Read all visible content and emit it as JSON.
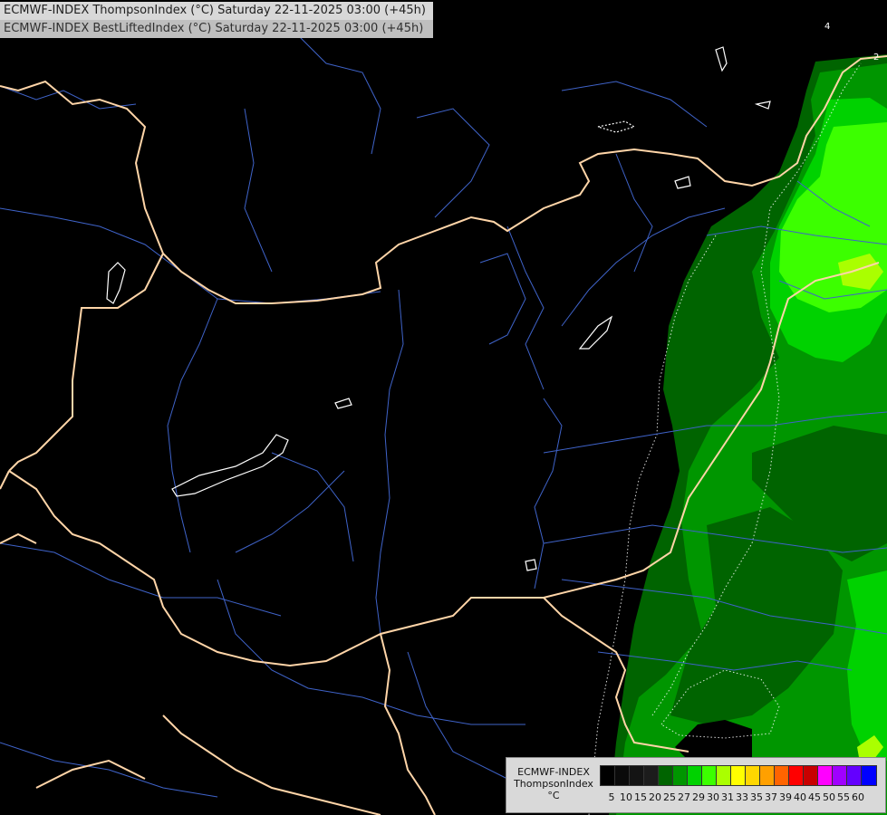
{
  "titles": {
    "line1": "ECMWF-INDEX ThompsonIndex (°C) Saturday 22-11-2025 03:00 (+45h)",
    "line2": "ECMWF-INDEX BestLiftedIndex (°C) Saturday 22-11-2025 03:00 (+45h)"
  },
  "legend": {
    "line1": "ECMWF-INDEX",
    "line2": "ThompsonIndex",
    "unit": "°C",
    "ticks": [
      "5",
      "10",
      "15",
      "20",
      "25",
      "27",
      "29",
      "30",
      "31",
      "33",
      "35",
      "37",
      "39",
      "40",
      "45",
      "50",
      "55",
      "60"
    ],
    "colors": [
      "#000000",
      "#0a0a0a",
      "#141414",
      "#1c1c1c",
      "#006400",
      "#009600",
      "#00d200",
      "#3cff00",
      "#aaff00",
      "#ffff00",
      "#ffd700",
      "#ffa000",
      "#ff6400",
      "#ff0000",
      "#c80000",
      "#ff00ff",
      "#a000ff",
      "#6400ff",
      "#0000ff"
    ]
  },
  "contour_labels": {
    "a": "4",
    "b": "2"
  },
  "colors": {
    "background": "#000000",
    "borders": "#ffd5a8",
    "rivers": "#3f63c9",
    "lakes": "#ffffff",
    "dark_green": "#006400",
    "mid_green": "#009600",
    "bright_green": "#00d200",
    "lime": "#3cff00",
    "yellow_green": "#aaff00"
  }
}
